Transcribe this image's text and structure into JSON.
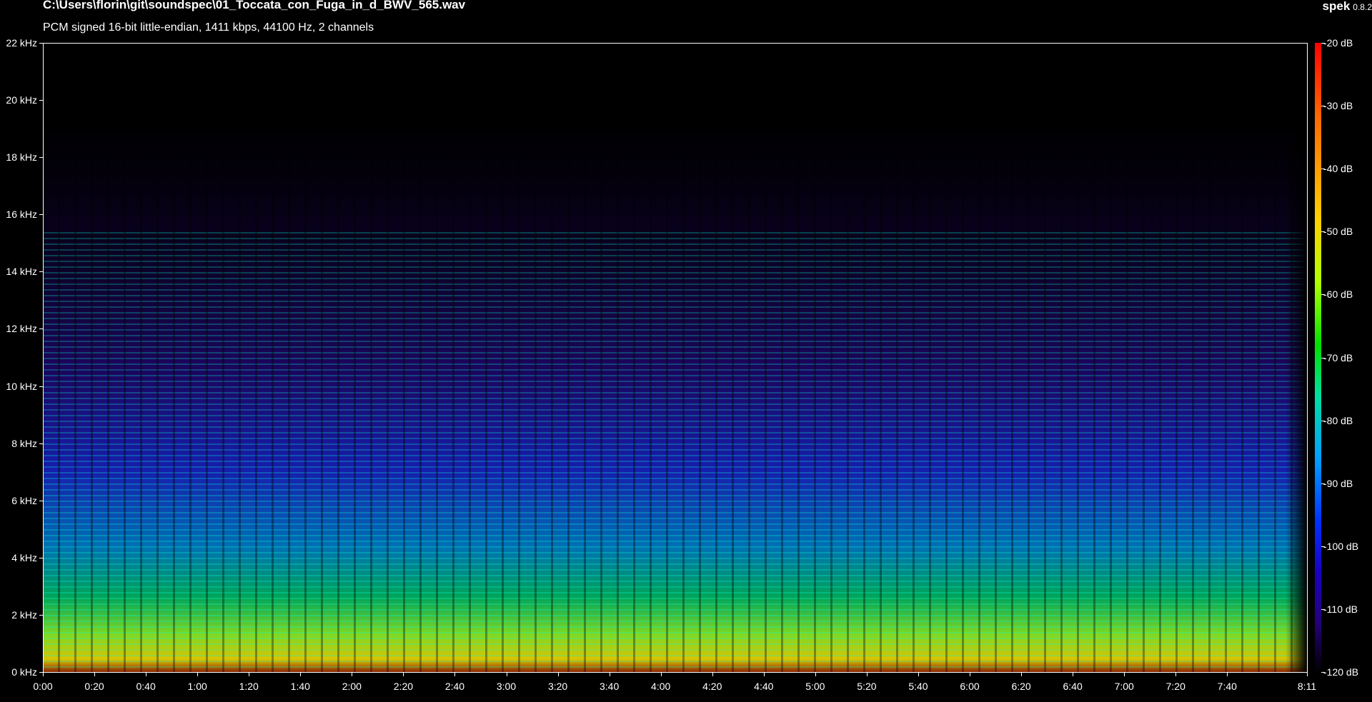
{
  "window": {
    "file_path": "C:\\Users\\florin\\git\\soundspec\\01_Toccata_con_Fuga_in_d_BWV_565.wav",
    "audio_info": "PCM signed 16-bit little-endian, 1411 kbps, 44100 Hz, 2 channels",
    "app_name": "spek",
    "app_version": "0.8.2"
  },
  "spectrogram": {
    "frequency_ticks": [
      "22 kHz",
      "20 kHz",
      "18 kHz",
      "16 kHz",
      "14 kHz",
      "12 kHz",
      "10 kHz",
      "8 kHz",
      "6 kHz",
      "4 kHz",
      "2 kHz",
      "0 kHz"
    ],
    "time_ticks": [
      "0:00",
      "0:20",
      "0:40",
      "1:00",
      "1:20",
      "1:40",
      "2:00",
      "2:20",
      "2:40",
      "3:00",
      "3:20",
      "3:40",
      "4:00",
      "4:20",
      "4:40",
      "5:00",
      "5:20",
      "5:40",
      "6:00",
      "6:20",
      "6:40",
      "7:00",
      "7:20",
      "7:40",
      "8:11"
    ],
    "colorbar_ticks": [
      "-20 dB",
      "-30 dB",
      "-40 dB",
      "-50 dB",
      "-60 dB",
      "-70 dB",
      "-80 dB",
      "-90 dB",
      "-100 dB",
      "-110 dB",
      "-120 dB"
    ],
    "colors": {
      "max": "#ff0000",
      "high": "#ffd000",
      "mid_high": "#00e000",
      "mid": "#00a0ff",
      "low": "#0030ff",
      "min": "#000000"
    }
  }
}
